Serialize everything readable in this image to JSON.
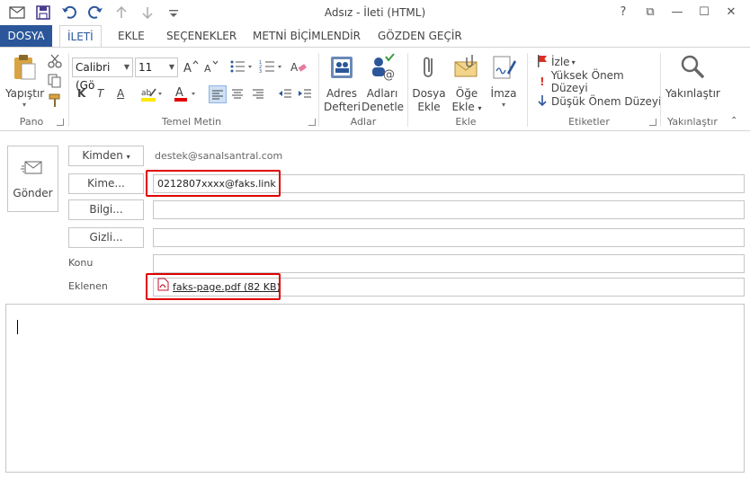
{
  "window": {
    "title": "Adsız - İleti (HTML)",
    "controls": {
      "help": "?",
      "restore_ribbon": "⧉",
      "minimize": "—",
      "maximize": "☐",
      "close": "✕"
    }
  },
  "quick_access": [
    "save-icon",
    "undo-icon",
    "redo-icon",
    "up-arrow-icon",
    "down-arrow-icon",
    "customize-icon"
  ],
  "tabs": {
    "file": "DOSYA",
    "items": [
      "İLETİ",
      "EKLE",
      "SEÇENEKLER",
      "METNİ BİÇİMLENDİR",
      "GÖZDEN GEÇİR"
    ]
  },
  "ribbon": {
    "clipboard": {
      "paste": "Yapıştır",
      "label": "Pano"
    },
    "basic_text": {
      "font_name": "Calibri (Gö",
      "font_size": "11",
      "bold": "K",
      "italic": "T",
      "underline": "A",
      "label": "Temel Metin",
      "highlight_color": "#ffe600",
      "font_color": "#e00000"
    },
    "names": {
      "address_book": "Adres Defteri",
      "check_names": "Adları Denetle",
      "label": "Adlar"
    },
    "include": {
      "attach_file": "Dosya Ekle",
      "attach_item": "Öğe Ekle",
      "signature": "İmza",
      "label": "Ekle"
    },
    "tags": {
      "follow_up": "İzle",
      "high_importance": "Yüksek Önem Düzeyi",
      "low_importance": "Düşük Önem Düzeyi",
      "label": "Etiketler"
    },
    "zoom": {
      "zoom": "Yakınlaştır",
      "label": "Yakınlaştır"
    }
  },
  "compose": {
    "send": "Gönder",
    "from_button": "Kimden",
    "from_value": "destek@sanalsantral.com",
    "to_button": "Kime...",
    "to_value": "0212807xxxx@faks.link",
    "cc_button": "Bilgi...",
    "cc_value": "",
    "bcc_button": "Gizli...",
    "bcc_value": "",
    "subject_label": "Konu",
    "subject_value": "",
    "attached_label": "Eklenen",
    "attachment": "faks-page.pdf (82 KB)",
    "highlight_color": "#e00000"
  },
  "colors": {
    "accent": "#2b579a",
    "border": "#c6c6c6",
    "highlight": "#e00000"
  }
}
